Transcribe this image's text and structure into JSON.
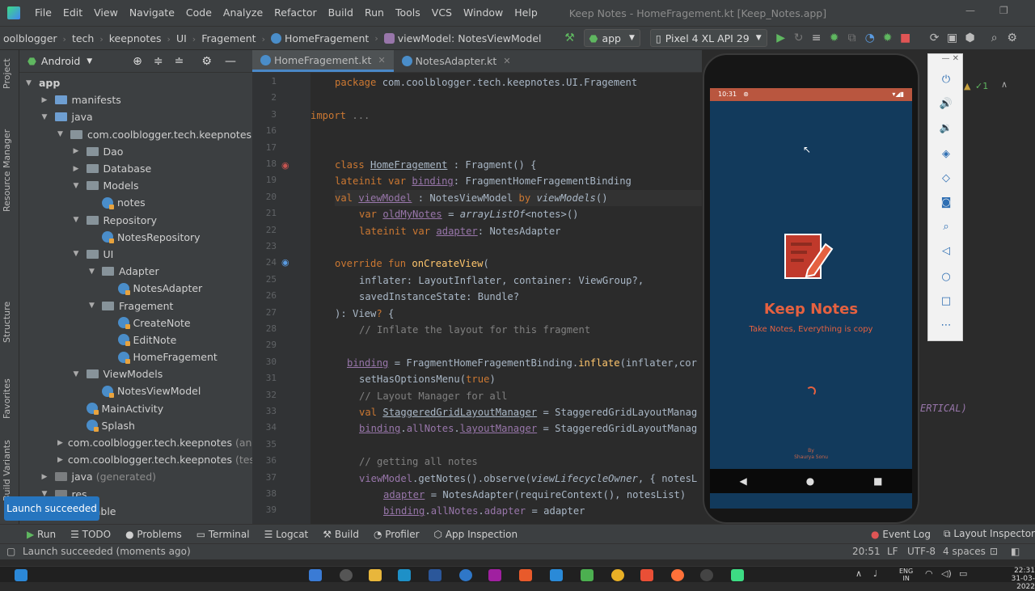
{
  "menubar": {
    "items": [
      "File",
      "Edit",
      "View",
      "Navigate",
      "Code",
      "Analyze",
      "Refactor",
      "Build",
      "Run",
      "Tools",
      "VCS",
      "Window",
      "Help"
    ],
    "title": "Keep Notes - HomeFragement.kt [Keep_Notes.app]"
  },
  "nav": {
    "crumbs": [
      "oolblogger",
      "tech",
      "keepnotes",
      "UI",
      "Fragement"
    ],
    "file": "HomeFragement",
    "member": "viewModel: NotesViewModel",
    "config": "app",
    "device": "Pixel 4 XL API 29"
  },
  "project": {
    "view": "Android",
    "tree": [
      {
        "label": "app",
        "depth": 0,
        "arrow": "▼",
        "icon": "none",
        "bold": true
      },
      {
        "label": "manifests",
        "depth": 1,
        "arrow": "▶",
        "icon": "folder-blue"
      },
      {
        "label": "java",
        "depth": 1,
        "arrow": "▼",
        "icon": "folder-blue"
      },
      {
        "label": "com.coolblogger.tech.keepnotes",
        "depth": 2,
        "arrow": "▼",
        "icon": "folder"
      },
      {
        "label": "Dao",
        "depth": 3,
        "arrow": "▶",
        "icon": "folder"
      },
      {
        "label": "Database",
        "depth": 3,
        "arrow": "▶",
        "icon": "folder"
      },
      {
        "label": "Models",
        "depth": 3,
        "arrow": "▼",
        "icon": "folder"
      },
      {
        "label": "notes",
        "depth": 4,
        "arrow": "",
        "icon": "kotlin"
      },
      {
        "label": "Repository",
        "depth": 3,
        "arrow": "▼",
        "icon": "folder"
      },
      {
        "label": "NotesRepository",
        "depth": 4,
        "arrow": "",
        "icon": "kotlin"
      },
      {
        "label": "UI",
        "depth": 3,
        "arrow": "▼",
        "icon": "folder"
      },
      {
        "label": "Adapter",
        "depth": 4,
        "arrow": "▼",
        "icon": "folder"
      },
      {
        "label": "NotesAdapter",
        "depth": 5,
        "arrow": "",
        "icon": "kotlin"
      },
      {
        "label": "Fragement",
        "depth": 4,
        "arrow": "▼",
        "icon": "folder"
      },
      {
        "label": "CreateNote",
        "depth": 5,
        "arrow": "",
        "icon": "kotlin"
      },
      {
        "label": "EditNote",
        "depth": 5,
        "arrow": "",
        "icon": "kotlin"
      },
      {
        "label": "HomeFragement",
        "depth": 5,
        "arrow": "",
        "icon": "kotlin"
      },
      {
        "label": "ViewModels",
        "depth": 3,
        "arrow": "▼",
        "icon": "folder"
      },
      {
        "label": "NotesViewModel",
        "depth": 4,
        "arrow": "",
        "icon": "kotlin"
      },
      {
        "label": "MainActivity",
        "depth": 3,
        "arrow": "",
        "icon": "kotlin"
      },
      {
        "label": "Splash",
        "depth": 3,
        "arrow": "",
        "icon": "kotlin"
      },
      {
        "label": "com.coolblogger.tech.keepnotes",
        "suffix": "(and",
        "depth": 2,
        "arrow": "▶",
        "icon": "folder"
      },
      {
        "label": "com.coolblogger.tech.keepnotes",
        "suffix": "(test",
        "depth": 2,
        "arrow": "▶",
        "icon": "folder"
      },
      {
        "label": "java",
        "suffix": "(generated)",
        "depth": 1,
        "arrow": "▶",
        "icon": "folder-gray"
      },
      {
        "label": "res",
        "depth": 1,
        "arrow": "▼",
        "icon": "folder-gray"
      },
      {
        "label": "wable",
        "depth": 3,
        "arrow": "",
        "icon": "none"
      }
    ]
  },
  "leftstrip": [
    "Project",
    "Resource Manager",
    "Structure",
    "Favorites",
    "Build Variants"
  ],
  "tabs": [
    "HomeFragement.kt",
    "NotesAdapter.kt"
  ],
  "code": [
    {
      "n": "1",
      "t": [
        [
          "kw",
          "package "
        ],
        [
          "pk",
          "com.coolblogger.tech.keepnotes.UI.Fragement"
        ]
      ],
      "i": 1
    },
    {
      "n": "2",
      "t": [],
      "i": 0
    },
    {
      "n": "3",
      "t": [
        [
          "kw",
          "import "
        ],
        [
          "cm",
          "..."
        ]
      ],
      "i": 0
    },
    {
      "n": "16",
      "t": [],
      "i": 0
    },
    {
      "n": "17",
      "t": [],
      "i": 0
    },
    {
      "n": "18",
      "t": [
        [
          "kw",
          "class "
        ],
        [
          "id ul",
          "HomeFragement"
        ],
        [
          "id",
          " : Fragment() {"
        ]
      ],
      "i": 1
    },
    {
      "n": "19",
      "t": [
        [
          "kw",
          "lateinit var "
        ],
        [
          "pr ul",
          "binding"
        ],
        [
          "id",
          ": FragmentHomeFragementBinding"
        ]
      ],
      "i": 1
    },
    {
      "n": "20",
      "t": [
        [
          "kw",
          "val "
        ],
        [
          "pr ul",
          "viewModel"
        ],
        [
          "id",
          " : NotesViewModel "
        ],
        [
          "kw",
          "by "
        ],
        [
          "it",
          "viewModels"
        ],
        [
          "id",
          "()"
        ]
      ],
      "i": 1
    },
    {
      "n": "21",
      "t": [
        [
          "kw",
          "var "
        ],
        [
          "pr ul",
          "oldMyNotes"
        ],
        [
          "id",
          " = "
        ],
        [
          "it",
          "arrayListOf"
        ],
        [
          "id",
          "<notes>()"
        ]
      ],
      "i": 2
    },
    {
      "n": "22",
      "t": [
        [
          "kw",
          "lateinit var "
        ],
        [
          "pr ul",
          "adapter"
        ],
        [
          "id",
          ": NotesAdapter"
        ]
      ],
      "i": 2
    },
    {
      "n": "23",
      "t": [],
      "i": 0
    },
    {
      "n": "24",
      "t": [
        [
          "kw",
          "override fun "
        ],
        [
          "fn",
          "onCreateView"
        ],
        [
          "id",
          "("
        ]
      ],
      "i": 1
    },
    {
      "n": "25",
      "t": [
        [
          "id",
          "inflater: LayoutInflater, container: ViewGroup?,"
        ]
      ],
      "i": 2
    },
    {
      "n": "26",
      "t": [
        [
          "id",
          "savedInstanceState: Bundle?"
        ]
      ],
      "i": 2
    },
    {
      "n": "27",
      "t": [
        [
          "id",
          "): View"
        ],
        [
          "kw",
          "?"
        ],
        [
          "id",
          " {"
        ]
      ],
      "i": 1
    },
    {
      "n": "28",
      "t": [
        [
          "cm",
          "// Inflate the layout for this fragment"
        ]
      ],
      "i": 2
    },
    {
      "n": "29",
      "t": [],
      "i": 0
    },
    {
      "n": "30",
      "t": [
        [
          "pr ul",
          "binding"
        ],
        [
          "id",
          " = FragmentHomeFragementBinding."
        ],
        [
          "fn",
          "inflate"
        ],
        [
          "id",
          "(inflater,cor"
        ]
      ],
      "i": 1.5
    },
    {
      "n": "31",
      "t": [
        [
          "id",
          "setHasOptionsMenu("
        ],
        [
          "kw",
          "true"
        ],
        [
          "id",
          ")"
        ]
      ],
      "i": 2
    },
    {
      "n": "32",
      "t": [
        [
          "cm",
          "// Layout Manager for all"
        ]
      ],
      "i": 2
    },
    {
      "n": "33",
      "t": [
        [
          "kw",
          "val "
        ],
        [
          "id ul",
          "StaggeredGridLayoutManager"
        ],
        [
          "id",
          " = StaggeredGridLayoutManag"
        ]
      ],
      "i": 2
    },
    {
      "n": "34",
      "t": [
        [
          "pr ul",
          "binding"
        ],
        [
          "id",
          "."
        ],
        [
          "pr",
          "allNotes"
        ],
        [
          "id",
          "."
        ],
        [
          "pr ul",
          "layoutManager"
        ],
        [
          "id",
          " = StaggeredGridLayoutManag"
        ]
      ],
      "i": 2
    },
    {
      "n": "35",
      "t": [],
      "i": 0
    },
    {
      "n": "36",
      "t": [
        [
          "cm",
          "// getting all notes"
        ]
      ],
      "i": 2
    },
    {
      "n": "37",
      "t": [
        [
          "pr",
          "viewModel"
        ],
        [
          "id",
          ".getNotes().observe("
        ],
        [
          "it",
          "viewLifecycleOwner"
        ],
        [
          "id",
          ", { notesL"
        ]
      ],
      "i": 2
    },
    {
      "n": "38",
      "t": [
        [
          "pr ul",
          "adapter"
        ],
        [
          "id",
          " = NotesAdapter(requireContext(), notesList)"
        ]
      ],
      "i": 3
    },
    {
      "n": "39",
      "t": [
        [
          "pr ul",
          "binding"
        ],
        [
          "id",
          "."
        ],
        [
          "pr",
          "allNotes"
        ],
        [
          "id",
          "."
        ],
        [
          "pr",
          "adapter"
        ],
        [
          "id",
          " = adapter"
        ]
      ],
      "i": 3
    }
  ],
  "rightcode": "ERTICAL)",
  "phone": {
    "time": "10:31",
    "app_title": "Keep Notes",
    "app_sub": "Take Notes, Everything is copy",
    "by": "By",
    "author": "Shaurya Sonu"
  },
  "toast": "Launch succeeded",
  "bottomtabs": [
    "Run",
    "TODO",
    "Problems",
    "Terminal",
    "Logcat",
    "Build",
    "Profiler",
    "App Inspection"
  ],
  "bottomright": [
    "Event Log",
    "Layout Inspector"
  ],
  "status": {
    "msg": "Launch succeeded (moments ago)",
    "pos": "20:51",
    "lf": "LF",
    "enc": "UTF-8",
    "indent": "4 spaces"
  },
  "taskbar": {
    "lang1": "ENG",
    "lang2": "IN",
    "time": "22:31",
    "date": "31-03-2022"
  },
  "colors": {
    "kotlin": "#4a8dc9",
    "accent": "#e56140",
    "screen": "#123a5c"
  }
}
